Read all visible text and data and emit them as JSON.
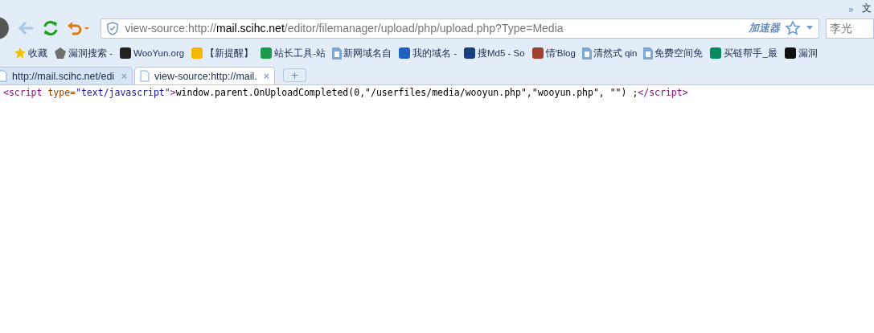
{
  "top_strip": {
    "chevron": "»",
    "menu_text": "文"
  },
  "toolbar": {
    "address": [
      {
        "text": "view-source:http://",
        "strong": false
      },
      {
        "text": "mail.scihc.net",
        "strong": true
      },
      {
        "text": "/editor/filemanager/upload/php/upload.php?Type=Media",
        "strong": false
      }
    ],
    "accelerator": "加速器",
    "search_placeholder": "李光"
  },
  "bookmarks": [
    {
      "label": "收藏",
      "kind": "star",
      "color": "#f2c200"
    },
    {
      "label": "漏洞搜索 -",
      "kind": "badge",
      "color": "#707070"
    },
    {
      "label": "WooYun.org",
      "kind": "logo",
      "color": "#222222"
    },
    {
      "label": "【新提醒】",
      "kind": "logo",
      "color": "#f5b800"
    },
    {
      "label": "站长工具-站",
      "kind": "logo",
      "color": "#1a9a4a"
    },
    {
      "label": "新网域名自",
      "kind": "page",
      "color": "#7aa8dc"
    },
    {
      "label": "我的域名 -",
      "kind": "logo",
      "color": "#2060c0"
    },
    {
      "label": "搜Md5 - So",
      "kind": "logo",
      "color": "#1a3c80"
    },
    {
      "label": "情'Blog",
      "kind": "logo",
      "color": "#a04030"
    },
    {
      "label": "清然式 qin",
      "kind": "page",
      "color": "#7aa8dc"
    },
    {
      "label": "免费空间免",
      "kind": "page",
      "color": "#7aa8dc"
    },
    {
      "label": "买链帮手_最",
      "kind": "logo",
      "color": "#0a8a60"
    },
    {
      "label": "漏洞",
      "kind": "logo",
      "color": "#111111"
    }
  ],
  "tabs": [
    {
      "title": "http://mail.scihc.net/edi",
      "selected": false,
      "close": "×"
    },
    {
      "title": "view-source:http://mail.",
      "selected": true,
      "close": "×"
    }
  ],
  "new_tab": "+",
  "source_line": [
    {
      "text": "<script",
      "kind": "tag"
    },
    {
      "text": " type=",
      "kind": "attr"
    },
    {
      "text": "\"text/javascript\"",
      "kind": "value"
    },
    {
      "text": ">",
      "kind": "tag"
    },
    {
      "text": "window.parent.OnUploadCompleted(0,\"/userfiles/media/wooyun.php\",\"wooyun.php\", \"\") ;",
      "kind": "text"
    },
    {
      "text": "</script>",
      "kind": "tag"
    }
  ]
}
